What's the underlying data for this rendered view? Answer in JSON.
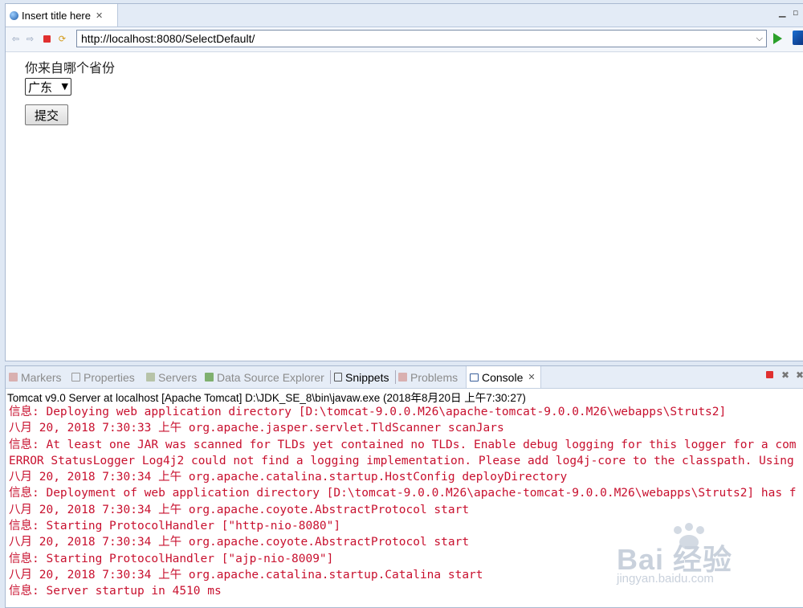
{
  "editor": {
    "tab_title": "Insert title here",
    "url": "http://localhost:8080/SelectDefault/"
  },
  "page": {
    "question": "你来自哪个省份",
    "select_value": "广东",
    "submit_label": "提交"
  },
  "views": {
    "tabs": [
      {
        "label": "Markers"
      },
      {
        "label": "Properties"
      },
      {
        "label": "Servers"
      },
      {
        "label": "Data Source Explorer"
      },
      {
        "label": "Snippets"
      },
      {
        "label": "Problems"
      },
      {
        "label": "Console"
      }
    ],
    "active": "Console"
  },
  "console": {
    "server_line": "Tomcat v9.0 Server at localhost [Apache Tomcat] D:\\JDK_SE_8\\bin\\javaw.exe (2018年8月20日 上午7:30:27)",
    "lines": [
      "信息: Deploying web application directory [D:\\tomcat-9.0.0.M26\\apache-tomcat-9.0.0.M26\\webapps\\Struts2]",
      "八月 20, 2018 7:30:33 上午 org.apache.jasper.servlet.TldScanner scanJars",
      "信息: At least one JAR was scanned for TLDs yet contained no TLDs. Enable debug logging for this logger for a com",
      "ERROR StatusLogger Log4j2 could not find a logging implementation. Please add log4j-core to the classpath. Using",
      "八月 20, 2018 7:30:34 上午 org.apache.catalina.startup.HostConfig deployDirectory",
      "信息: Deployment of web application directory [D:\\tomcat-9.0.0.M26\\apache-tomcat-9.0.0.M26\\webapps\\Struts2] has f",
      "八月 20, 2018 7:30:34 上午 org.apache.coyote.AbstractProtocol start",
      "信息: Starting ProtocolHandler [\"http-nio-8080\"]",
      "八月 20, 2018 7:30:34 上午 org.apache.coyote.AbstractProtocol start",
      "信息: Starting ProtocolHandler [\"ajp-nio-8009\"]",
      "八月 20, 2018 7:30:34 上午 org.apache.catalina.startup.Catalina start",
      "信息: Server startup in 4510 ms"
    ]
  },
  "watermark": {
    "main": "Bai 经验",
    "sub": "jingyan.baidu.com"
  },
  "colors": {
    "log_text": "#c8102e",
    "panel_bg": "#dfe8f4"
  }
}
